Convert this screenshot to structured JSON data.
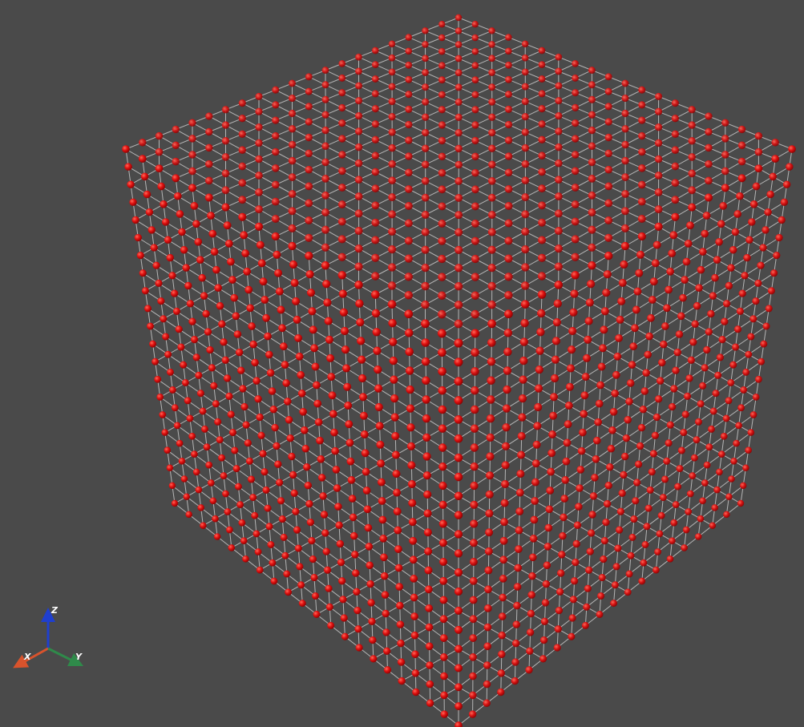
{
  "viewport": {
    "background_color": "#4a4a4a",
    "atom_color": "#e01010",
    "atom_shadow_color": "#7a0000",
    "bond_color": "#d9d9d9"
  },
  "lattice": {
    "cells_per_edge": 20
  },
  "axes": {
    "x": {
      "label": "X",
      "color": "#d9532c"
    },
    "y": {
      "label": "Y",
      "color": "#2f8a4a"
    },
    "z": {
      "label": "Z",
      "color": "#1f3fcf"
    }
  }
}
